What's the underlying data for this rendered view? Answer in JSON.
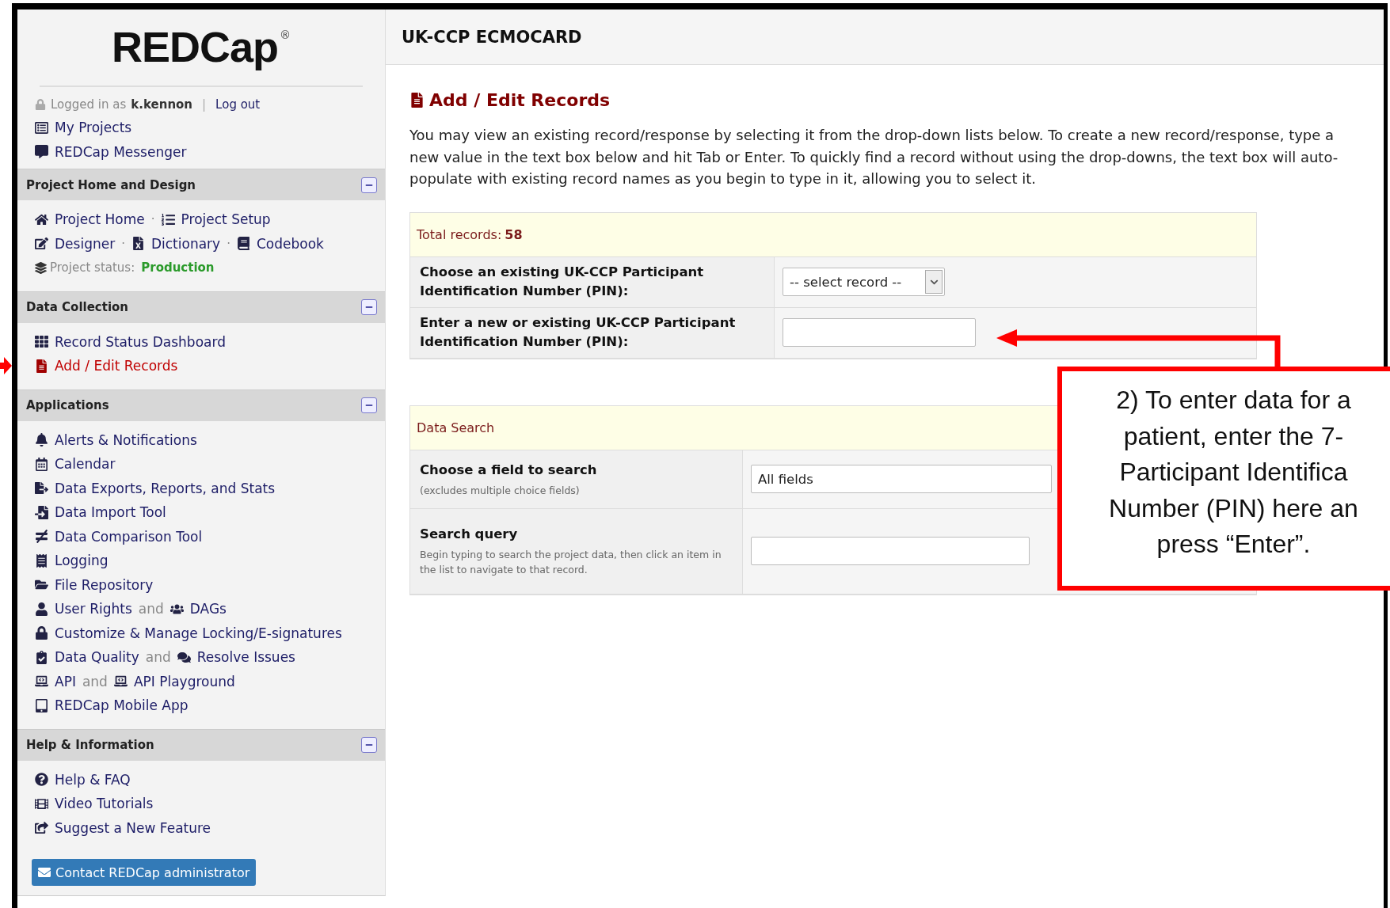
{
  "sidebar": {
    "logo": {
      "text": "REDCap",
      "mark": "®"
    },
    "login": {
      "prefix": "Logged in as",
      "user": "k.kennon",
      "separator": "|",
      "logout": "Log out"
    },
    "links": [
      {
        "label": "My Projects",
        "selected": false
      },
      {
        "label": "REDCap Messenger",
        "selected": false
      }
    ],
    "sections": [
      {
        "title": "Project Home and Design",
        "expanded": true,
        "rows": [
          {
            "parts": [
              {
                "kind": "link",
                "label": "Project Home",
                "selected": false
              },
              {
                "kind": "sep",
                "text": "·"
              },
              {
                "kind": "link",
                "label": "Project Setup",
                "selected": false
              }
            ]
          },
          {
            "parts": [
              {
                "kind": "link",
                "label": "Designer",
                "selected": false
              },
              {
                "kind": "sep",
                "text": "·"
              },
              {
                "kind": "link",
                "label": "Dictionary",
                "selected": false
              },
              {
                "kind": "sep",
                "text": "·"
              },
              {
                "kind": "link",
                "label": "Codebook",
                "selected": false
              }
            ]
          },
          {
            "parts": [
              {
                "kind": "status",
                "label": "Project status:",
                "value": "Production"
              }
            ]
          }
        ]
      },
      {
        "title": "Data Collection",
        "expanded": true,
        "rows": [
          {
            "parts": [
              {
                "kind": "link",
                "label": "Record Status Dashboard",
                "selected": false
              }
            ]
          },
          {
            "parts": [
              {
                "kind": "link",
                "label": "Add / Edit Records",
                "selected": true
              }
            ]
          }
        ]
      },
      {
        "title": "Applications",
        "expanded": true,
        "rows": [
          {
            "parts": [
              {
                "kind": "link",
                "label": "Alerts & Notifications",
                "selected": false
              }
            ]
          },
          {
            "parts": [
              {
                "kind": "link",
                "label": "Calendar",
                "selected": false
              }
            ]
          },
          {
            "parts": [
              {
                "kind": "link",
                "label": "Data Exports, Reports, and Stats",
                "selected": false
              }
            ]
          },
          {
            "parts": [
              {
                "kind": "link",
                "label": "Data Import Tool",
                "selected": false
              }
            ]
          },
          {
            "parts": [
              {
                "kind": "link",
                "label": "Data Comparison Tool",
                "selected": false
              }
            ]
          },
          {
            "parts": [
              {
                "kind": "link",
                "label": "Logging",
                "selected": false
              }
            ]
          },
          {
            "parts": [
              {
                "kind": "link",
                "label": "File Repository",
                "selected": false
              }
            ]
          },
          {
            "parts": [
              {
                "kind": "link",
                "label": "User Rights",
                "selected": false
              },
              {
                "kind": "and",
                "text": "and"
              },
              {
                "kind": "link",
                "label": "DAGs",
                "selected": false
              }
            ]
          },
          {
            "parts": [
              {
                "kind": "link",
                "label": "Customize & Manage Locking/E-signatures",
                "selected": false
              }
            ]
          },
          {
            "parts": [
              {
                "kind": "link",
                "label": "Data Quality",
                "selected": false
              },
              {
                "kind": "and",
                "text": "and"
              },
              {
                "kind": "link",
                "label": "Resolve Issues",
                "selected": false
              }
            ]
          },
          {
            "parts": [
              {
                "kind": "link",
                "label": "API",
                "selected": false
              },
              {
                "kind": "and",
                "text": "and"
              },
              {
                "kind": "link",
                "label": "API Playground",
                "selected": false
              }
            ]
          },
          {
            "parts": [
              {
                "kind": "link",
                "label": "REDCap Mobile App",
                "selected": false
              }
            ]
          }
        ]
      },
      {
        "title": "Help & Information",
        "expanded": true,
        "rows": [
          {
            "parts": [
              {
                "kind": "link",
                "label": "Help & FAQ",
                "selected": false
              }
            ]
          },
          {
            "parts": [
              {
                "kind": "link",
                "label": "Video Tutorials",
                "selected": false
              }
            ]
          },
          {
            "parts": [
              {
                "kind": "link",
                "label": "Suggest a New Feature",
                "selected": false
              }
            ]
          }
        ]
      }
    ],
    "contact_button": "Contact REDCap administrator"
  },
  "header": {
    "title": "UK-CCP ECMOCARD"
  },
  "page_title": "Add / Edit Records",
  "intro": "You may view an existing record/response by selecting it from the drop-down lists below. To create a new record/response, type a new value in the text box below and hit Tab or Enter. To quickly find a record without using the drop-downs, the text box will auto-populate with existing record names as you begin to type in it, allowing you to select it.",
  "records_box": {
    "total_label": "Total records:",
    "total": "58",
    "rows": [
      {
        "label": "Choose an existing UK-CCP Participant Identification Number (PIN):",
        "control": {
          "kind": "select",
          "value": "-- select record --"
        }
      },
      {
        "label": "Enter a new or existing UK-CCP Participant Identification Number (PIN):",
        "control": {
          "kind": "input"
        }
      }
    ]
  },
  "search_box": {
    "title": "Data Search",
    "rows": [
      {
        "label": "Choose a field to search",
        "hint": "(excludes multiple choice fields)",
        "control": {
          "kind": "wide_select",
          "value": "All fields"
        }
      },
      {
        "label": "Search query",
        "hint": "Begin typing to search the project data, then click an item in the list to navigate to that record.",
        "control": {
          "kind": "input"
        }
      }
    ]
  },
  "callout": {
    "lines": [
      "2) To enter data for a",
      "patient, enter the 7-",
      "Participant Identifica",
      "Number (PIN) here an",
      "press “Enter”."
    ]
  }
}
